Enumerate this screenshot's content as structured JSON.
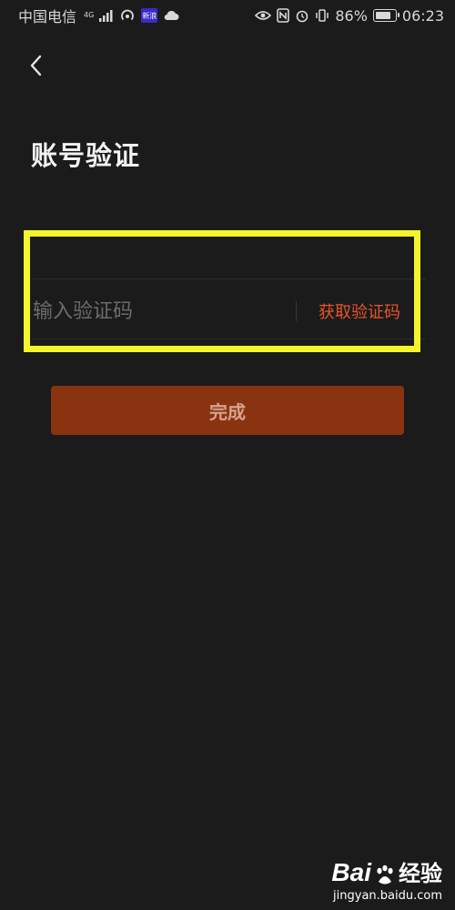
{
  "status_bar": {
    "carrier": "中国电信",
    "network": "4G",
    "sim_label": "新浪",
    "battery": "86%",
    "battery_level": 0.86,
    "time": "06:23"
  },
  "header": {
    "back_icon": "chevron-left-icon",
    "title": "账号验证"
  },
  "form": {
    "phone_value": "",
    "code_placeholder": "输入验证码",
    "get_code_label": "获取验证码"
  },
  "actions": {
    "done_label": "完成"
  },
  "watermark": {
    "brand": "Bai",
    "brand_suffix": "经验",
    "url": "jingyan.baidu.com"
  },
  "colors": {
    "background": "#1b1b1b",
    "accent": "#e8542a",
    "button": "#8a3310",
    "highlight": "#f4f52c"
  }
}
